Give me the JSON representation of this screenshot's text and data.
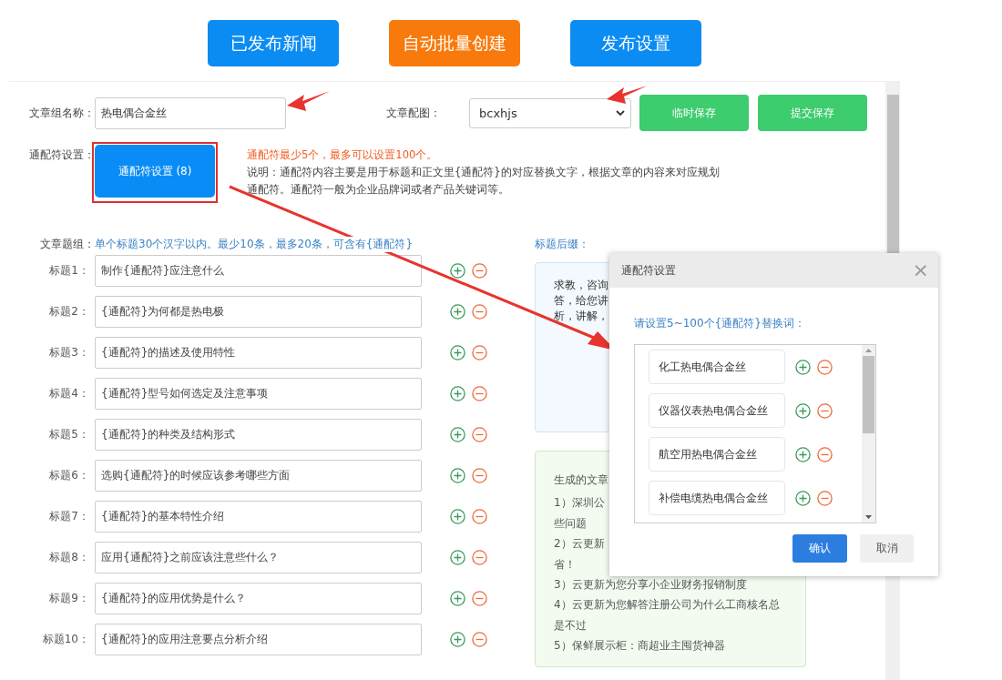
{
  "top_buttons": [
    {
      "label": "已发布新闻",
      "color": "#0b8cf3"
    },
    {
      "label": "自动批量创建",
      "color": "#f97a0c"
    },
    {
      "label": "发布设置",
      "color": "#0b8cf3"
    }
  ],
  "form": {
    "name_label": "文章组名称：",
    "name_value": "热电偶合金丝",
    "image_label": "文章配图：",
    "image_value": "bcxhjs",
    "save_buttons": [
      "临时保存",
      "提交保存"
    ],
    "wildcard_label": "通配符设置：",
    "wildcard_button": "通配符设置 (8)",
    "notes": [
      {
        "kind": "warning",
        "text": "通配符最少5个，最多可以设置100个。"
      },
      {
        "kind": "info",
        "text": "说明：通配符内容主要是用于标题和正文里{通配符}的对应替换文字，根据文章的内容来对应规划通配符。通配符一般为企业品牌词或者产品关键词等。"
      }
    ]
  },
  "titles": {
    "label": "文章题组：",
    "hint": "单个标题30个汉字以内。最少10条，最多20条，可含有{通配符}",
    "rows": [
      {
        "label": "标题1：",
        "value": "制作{通配符}应注意什么"
      },
      {
        "label": "标题2：",
        "value": "{通配符}为何都是热电极"
      },
      {
        "label": "标题3：",
        "value": "{通配符}的描述及使用特性"
      },
      {
        "label": "标题4：",
        "value": "{通配符}型号如何选定及注意事项"
      },
      {
        "label": "标题5：",
        "value": "{通配符}的种类及结构形式"
      },
      {
        "label": "标题6：",
        "value": "选购{通配符}的时候应该参考哪些方面"
      },
      {
        "label": "标题7：",
        "value": "{通配符}的基本特性介绍"
      },
      {
        "label": "标题8：",
        "value": "应用{通配符}之前应该注意些什么？"
      },
      {
        "label": "标题9：",
        "value": "{通配符}的应用优势是什么？"
      },
      {
        "label": "标题10：",
        "value": "{通配符}的应用注意要点分析介绍"
      }
    ]
  },
  "suffix": {
    "label": "标题后缀：",
    "lines": [
      "求教，咨询",
      "答，给您讲",
      "析，讲解，"
    ]
  },
  "generated": {
    "lines": [
      "生成的文章",
      "1）深圳公",
      "些问题",
      "2）云更新",
      "省！",
      "3）云更新为您分享小企业财务报销制度",
      "4）云更新为您解答注册公司为什么工商核名总",
      "是不过",
      "5）保鲜展示柜：商超业主囤货神器"
    ]
  },
  "dialog": {
    "title": "通配符设置",
    "close": "×",
    "prompt": "请设置5~100个{通配符}替换词：",
    "words": [
      "化工热电偶合金丝",
      "仪器仪表热电偶合金丝",
      "航空用热电偶合金丝",
      "补偿电缆热电偶合金丝"
    ],
    "confirm": "确认",
    "cancel": "取消"
  }
}
